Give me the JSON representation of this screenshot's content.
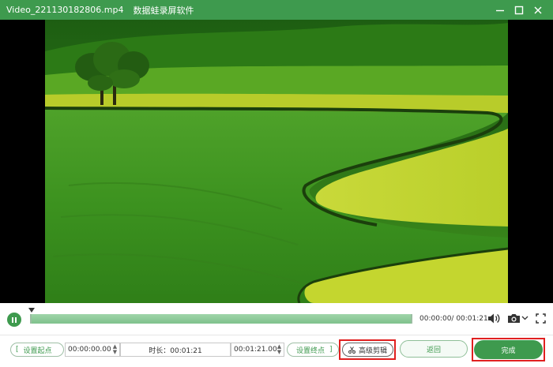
{
  "window": {
    "file_title": "Video_221130182806.mp4",
    "app_name": "数据蛙录屏软件",
    "controls": [
      "minimize-icon",
      "maximize-icon",
      "close-icon"
    ]
  },
  "player": {
    "current_time": "00:00:00",
    "total_time": "00:01:21",
    "time_display": "00:00:00/ 00:01:21",
    "progress": 0.0,
    "state": "playing",
    "icons": [
      "pause-icon",
      "volume-icon",
      "camera-icon",
      "chevron-down-icon",
      "fullscreen-icon"
    ]
  },
  "edit": {
    "set_start_label": "设置起点",
    "start_time": "00:00:00.00",
    "duration_label": "时长：00:01:21",
    "end_time": "00:01:21.00",
    "set_end_label": "设置终点",
    "advanced_edit_label": "高级剪辑",
    "back_label": "返回",
    "done_label": "完成"
  },
  "colors": {
    "accent": "#3e9a4e",
    "track": "#cfe8d4",
    "highlight": "#e02020"
  }
}
